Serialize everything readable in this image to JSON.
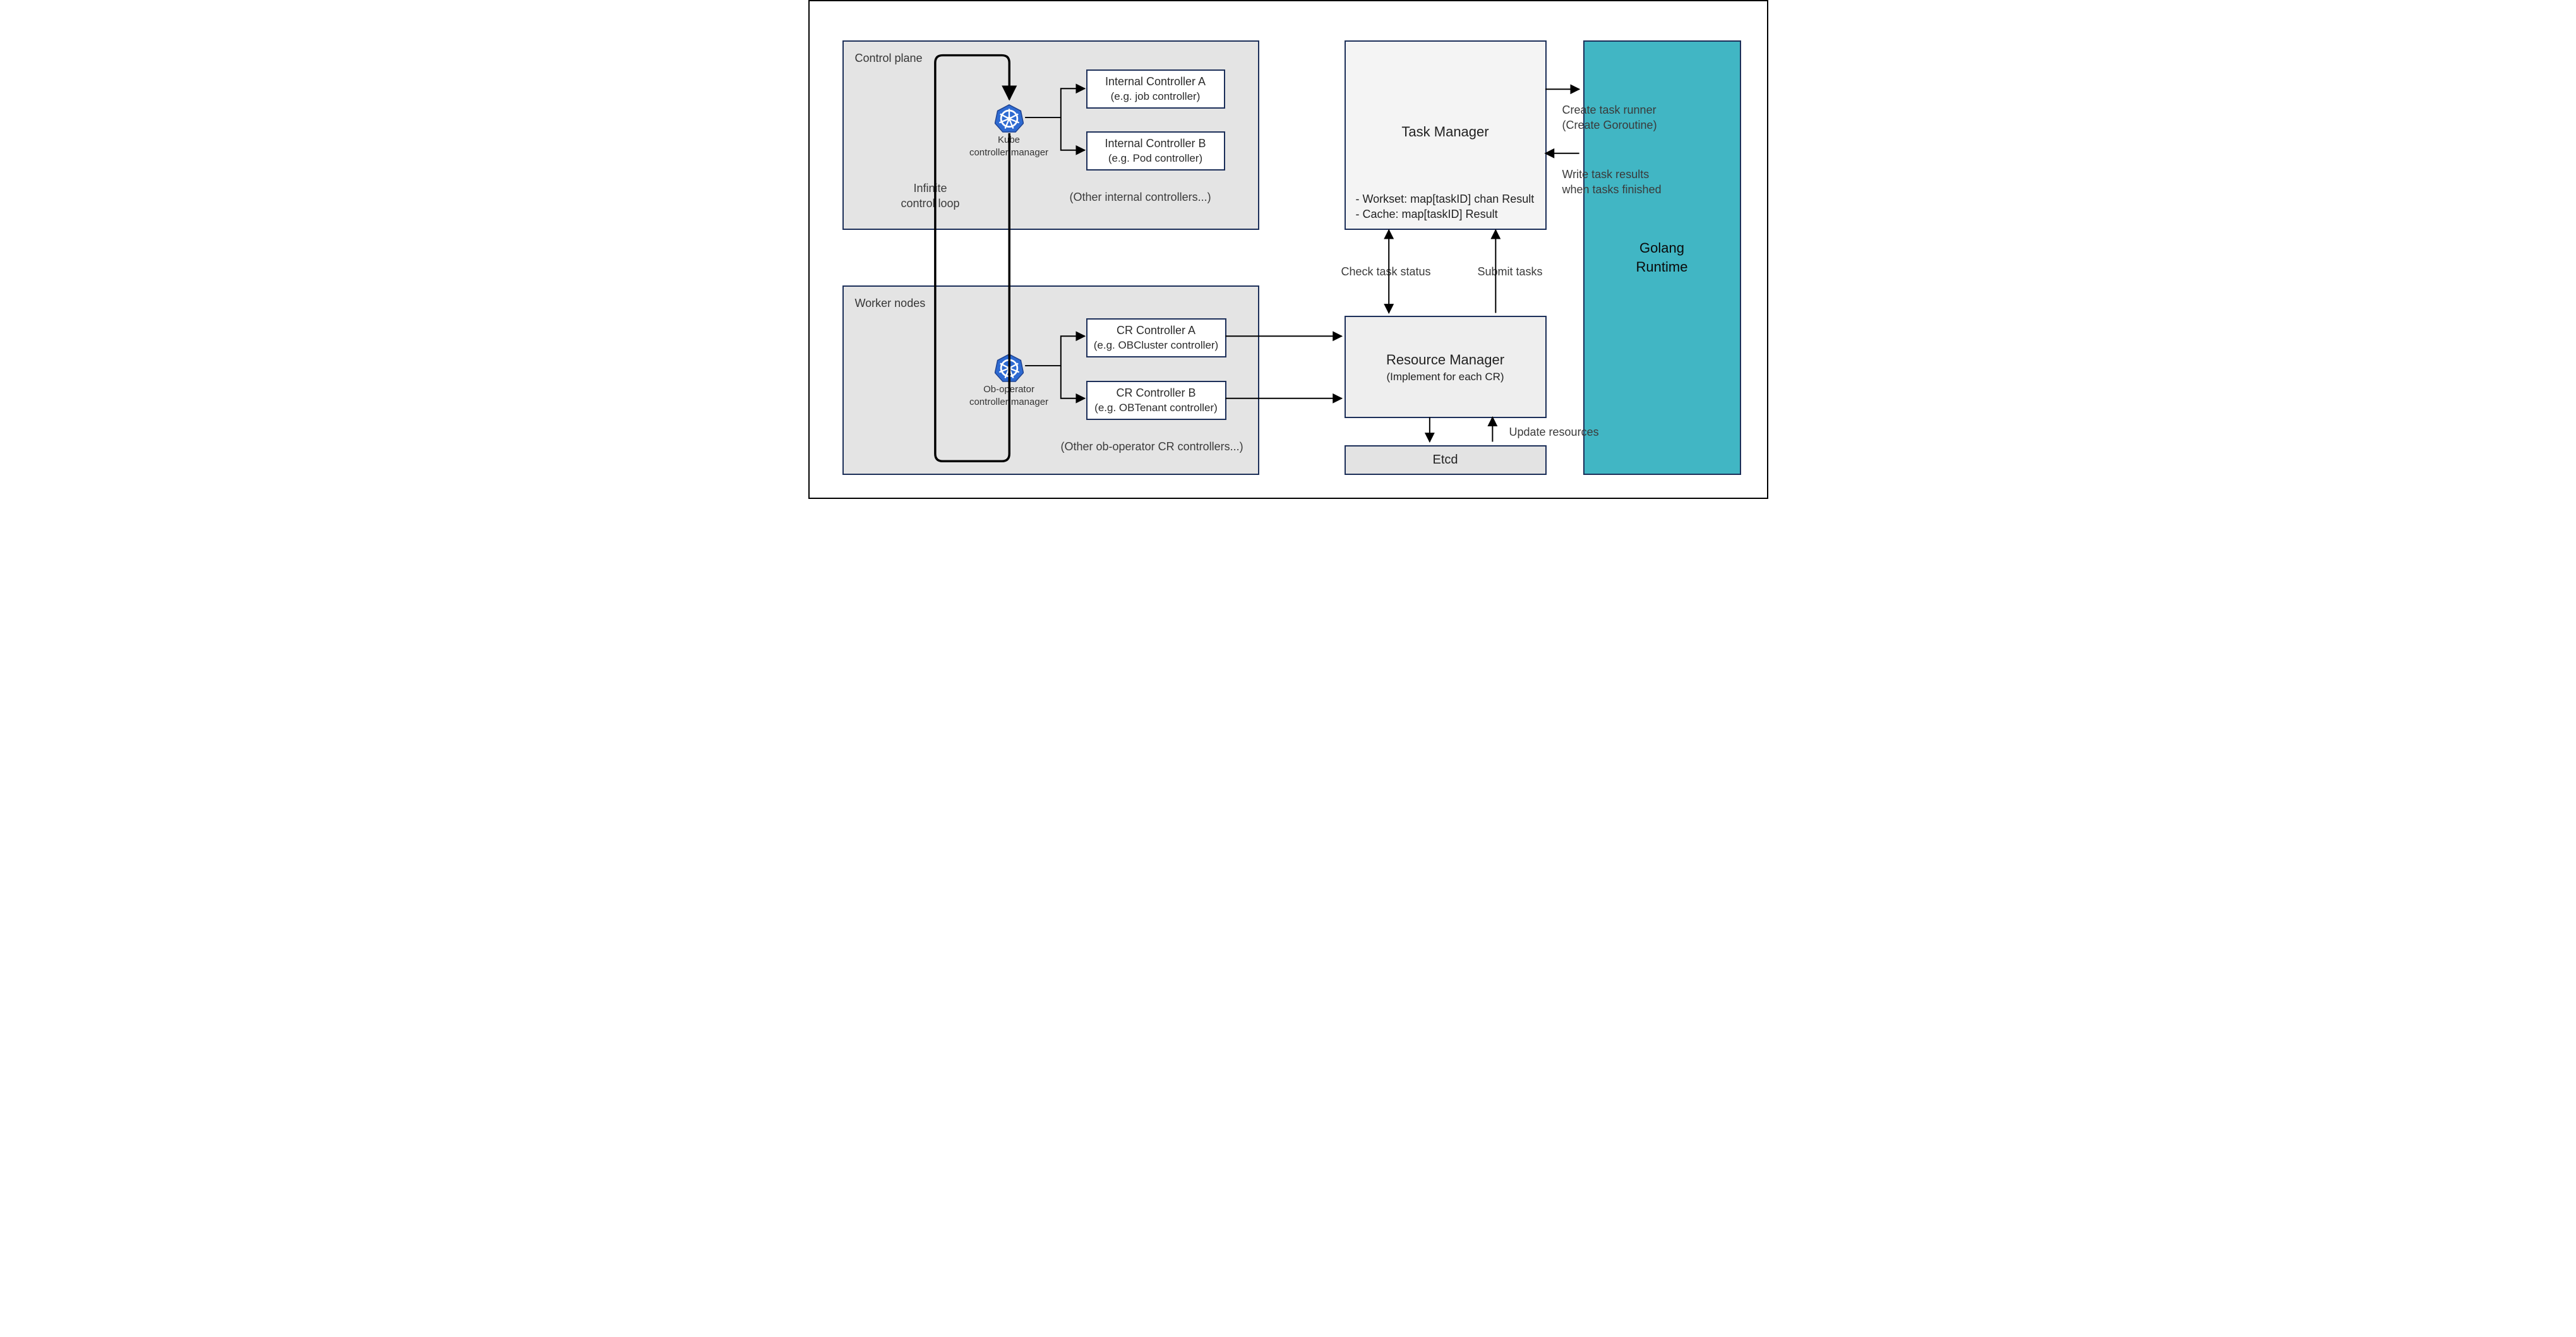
{
  "control_plane": {
    "label": "Control plane",
    "kube_mgr_l1": "Kube",
    "kube_mgr_l2": "controller manager",
    "ctrl_a_l1": "Internal Controller A",
    "ctrl_a_l2": "(e.g. job controller)",
    "ctrl_b_l1": "Internal Controller B",
    "ctrl_b_l2": "(e.g. Pod controller)",
    "others": "(Other internal controllers...)",
    "loop_l1": "Infinite",
    "loop_l2": "control loop"
  },
  "worker_nodes": {
    "label": "Worker nodes",
    "ob_mgr_l1": "Ob-operator",
    "ob_mgr_l2": "controller manager",
    "ctrl_a_l1": "CR Controller A",
    "ctrl_a_l2": "(e.g. OBCluster controller)",
    "ctrl_b_l1": "CR Controller B",
    "ctrl_b_l2": "(e.g. OBTenant controller)",
    "others": "(Other ob-operator CR controllers...)"
  },
  "task_manager": {
    "title": "Task Manager",
    "line1": "- Workset: map[taskID] chan Result",
    "line2": "- Cache: map[taskID] Result"
  },
  "resource_manager": {
    "title": "Resource Manager",
    "sub": "(Implement for each CR)"
  },
  "etcd": {
    "label": "Etcd"
  },
  "runtime": {
    "l1": "Golang",
    "l2": "Runtime"
  },
  "edges": {
    "check_status": "Check task status",
    "submit_tasks": "Submit tasks",
    "update_resources": "Update resources",
    "create_runner_l1": "Create task runner",
    "create_runner_l2": "(Create Goroutine)",
    "write_results_l1": "Write task results",
    "write_results_l2": "when tasks finished"
  }
}
